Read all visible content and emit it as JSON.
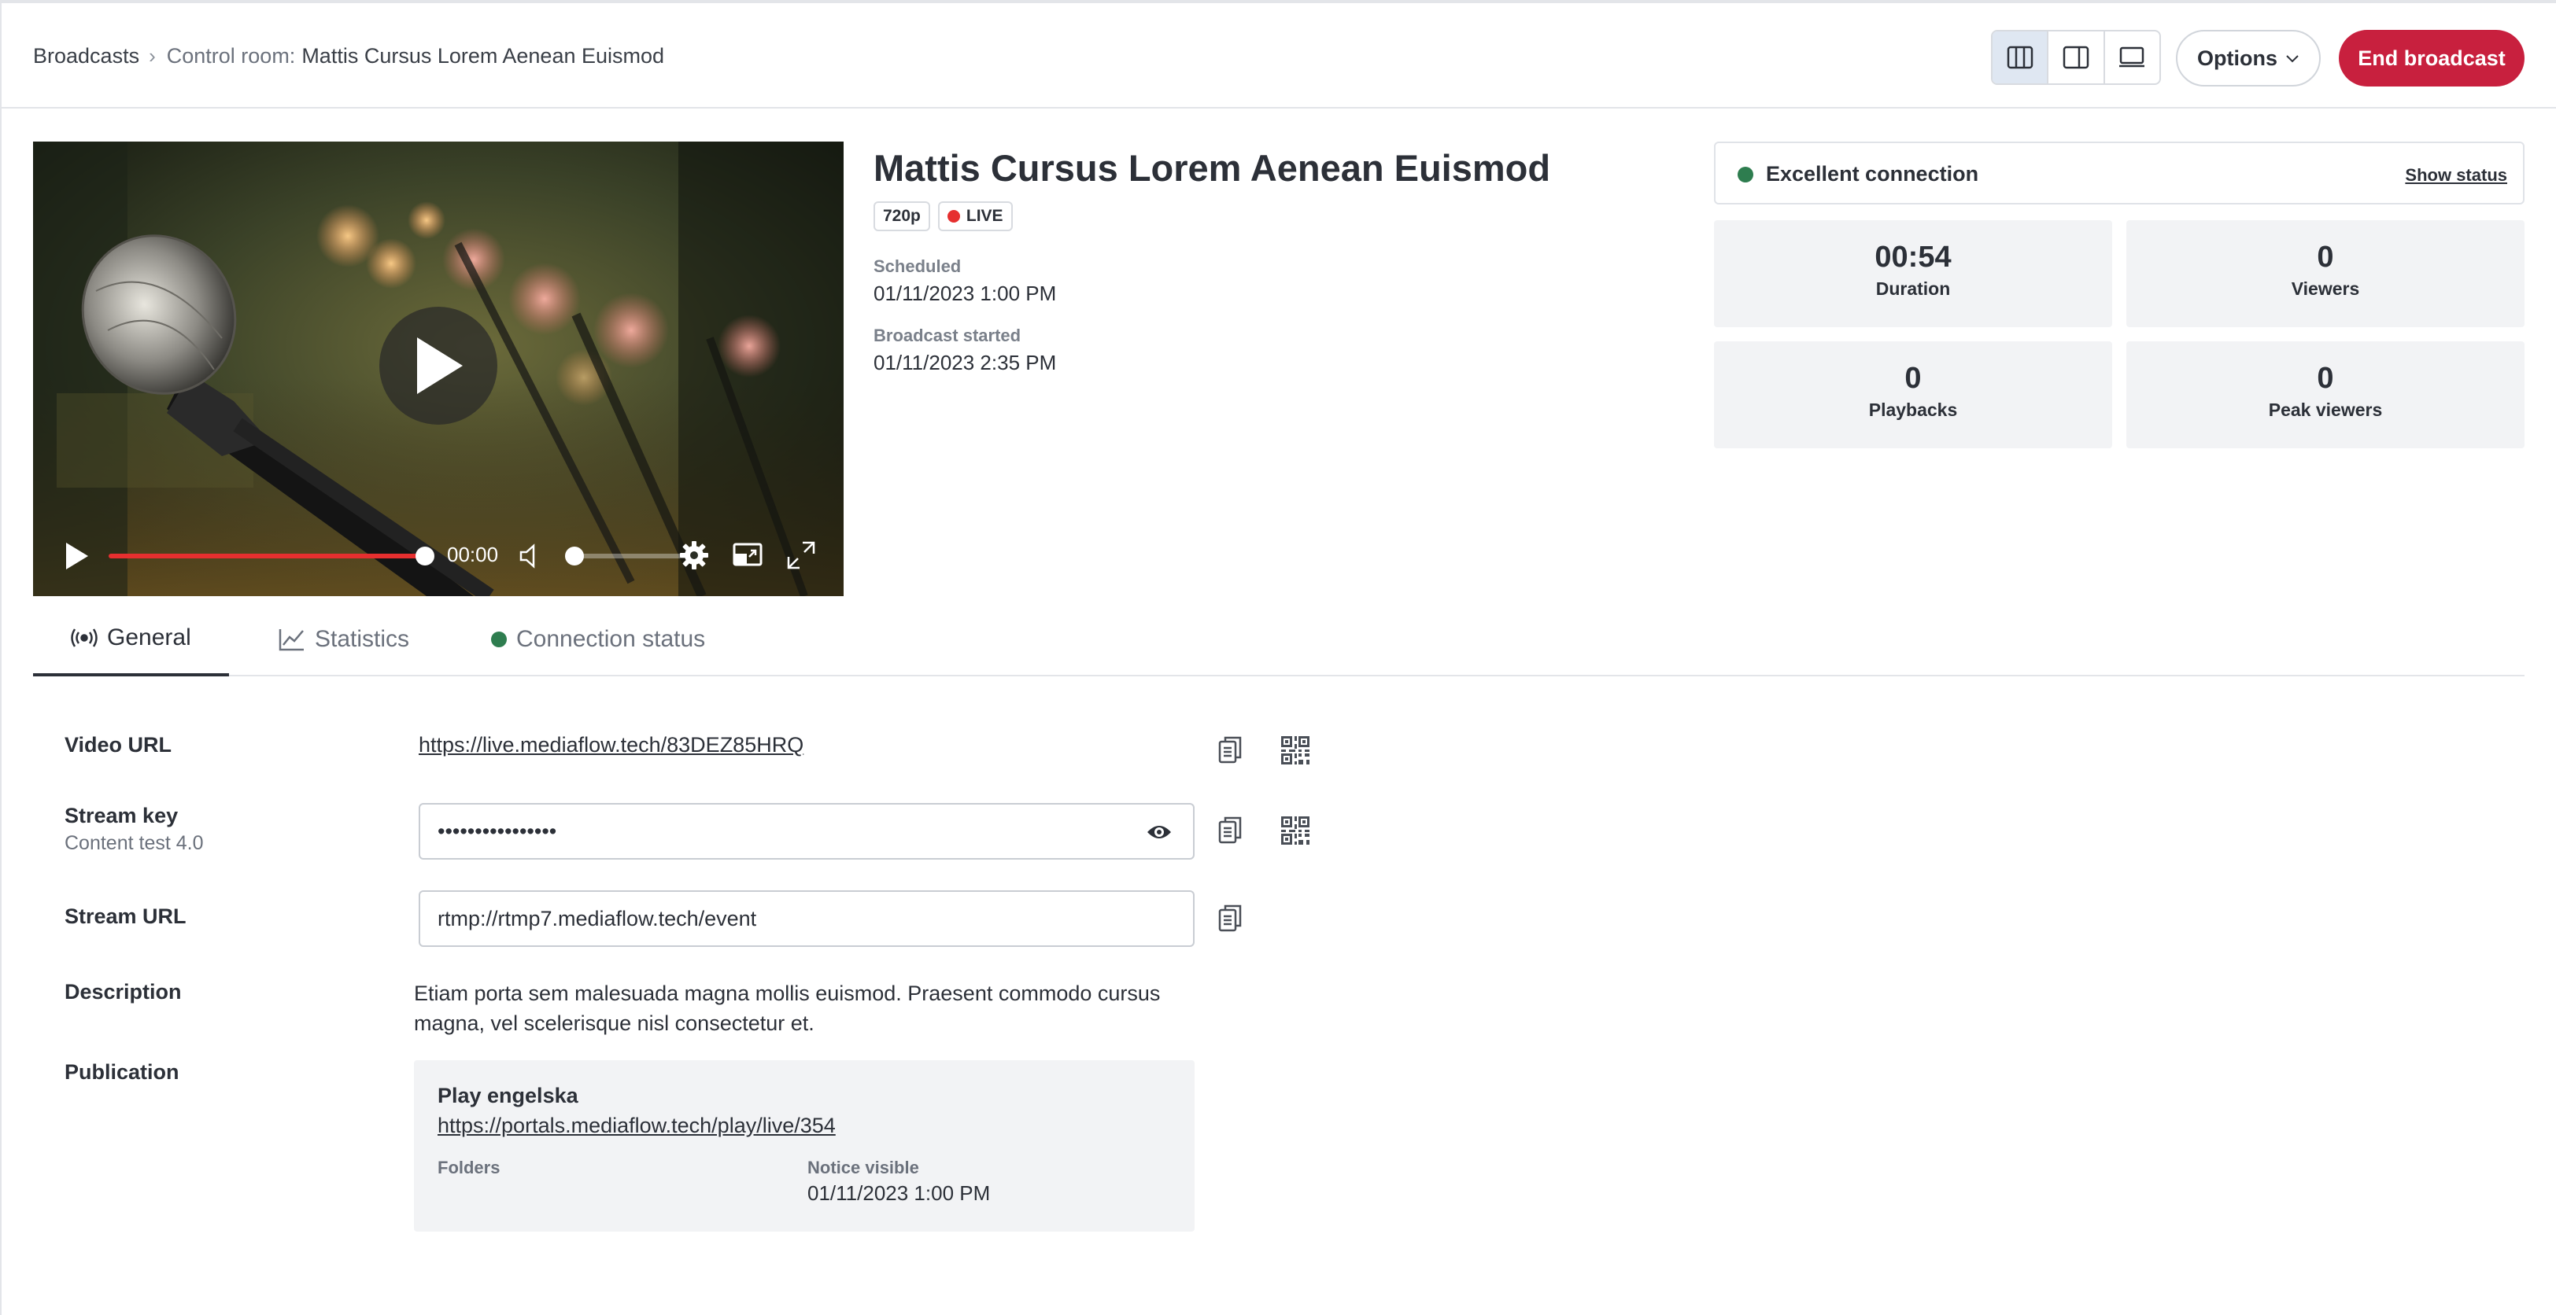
{
  "breadcrumb": {
    "root": "Broadcasts",
    "separator": "›",
    "prefix": "Control room:",
    "current": "Mattis Cursus Lorem Aenean Euismod"
  },
  "header": {
    "layout_views": [
      "columns-view-icon",
      "sidebar-view-icon",
      "monitor-view-icon"
    ],
    "options_label": "Options",
    "end_label": "End broadcast",
    "accent_color": "#c8203e"
  },
  "player": {
    "time": "00:00",
    "progress": 1.0,
    "volume": 0.0
  },
  "broadcast": {
    "title": "Mattis Cursus Lorem Aenean Euismod",
    "quality": "720p",
    "live_label": "LIVE",
    "scheduled_label": "Scheduled",
    "scheduled_value": "01/11/2023 1:00 PM",
    "started_label": "Broadcast started",
    "started_value": "01/11/2023 2:35 PM"
  },
  "connection": {
    "status": "Excellent connection",
    "status_color": "#2e7d4f",
    "show_status": "Show status"
  },
  "stats": [
    {
      "value": "00:54",
      "label": "Duration"
    },
    {
      "value": "0",
      "label": "Viewers"
    },
    {
      "value": "0",
      "label": "Playbacks"
    },
    {
      "value": "0",
      "label": "Peak viewers"
    }
  ],
  "tabs": [
    {
      "label": "General",
      "icon": "broadcast-icon",
      "active": true
    },
    {
      "label": "Statistics",
      "icon": "chart-icon",
      "active": false
    },
    {
      "label": "Connection status",
      "icon": "status-dot-icon",
      "active": false
    }
  ],
  "form": {
    "video_url_label": "Video URL",
    "video_url": "https://live.mediaflow.tech/83DEZ85HRQ",
    "stream_key_label": "Stream key",
    "stream_key_sub": "Content test 4.0",
    "stream_key_value": "••••••••••••••••",
    "stream_url_label": "Stream URL",
    "stream_url_value": "rtmp://rtmp7.mediaflow.tech/event",
    "description_label": "Description",
    "description": "Etiam porta sem malesuada magna mollis euismod. Praesent commodo cursus magna, vel scelerisque nisl consectetur et.",
    "publication_label": "Publication",
    "publication": {
      "title": "Play engelska",
      "link": "https://portals.mediaflow.tech/play/live/354",
      "folders_label": "Folders",
      "notice_label": "Notice visible",
      "notice_value": "01/11/2023 1:00 PM"
    }
  }
}
